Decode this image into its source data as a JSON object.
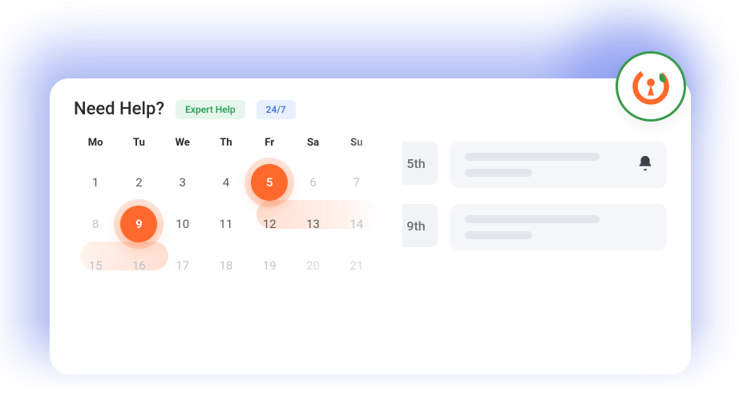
{
  "header": {
    "title": "Need Help?",
    "expert_badge": "Expert Help",
    "always_badge": "24/7"
  },
  "calendar": {
    "dow": [
      "Mo",
      "Tu",
      "We",
      "Th",
      "Fr",
      "Sa",
      "Su"
    ],
    "weeks": [
      [
        {
          "n": "1"
        },
        {
          "n": "2"
        },
        {
          "n": "3"
        },
        {
          "n": "4"
        },
        {
          "n": "5",
          "selected": true
        },
        {
          "n": "6",
          "muted": true
        },
        {
          "n": "7",
          "muted": true
        }
      ],
      [
        {
          "n": "8",
          "muted": true
        },
        {
          "n": "9",
          "selected": true
        },
        {
          "n": "10"
        },
        {
          "n": "11"
        },
        {
          "n": "12"
        },
        {
          "n": "13"
        },
        {
          "n": "14",
          "muted": true
        }
      ],
      [
        {
          "n": "15",
          "muted": true
        },
        {
          "n": "16",
          "muted": true
        },
        {
          "n": "17",
          "muted": true
        },
        {
          "n": "18",
          "muted": true
        },
        {
          "n": "19",
          "muted": true
        },
        {
          "n": "20",
          "faded": true
        },
        {
          "n": "21",
          "faded": true
        }
      ]
    ]
  },
  "events": [
    {
      "date_label": "5th",
      "has_bell": true
    },
    {
      "date_label": "9th",
      "has_bell": false
    }
  ],
  "colors": {
    "accent_orange": "#ff6a2c",
    "brand_green": "#3a9a4d",
    "glow_blue": "#7a8ff0"
  }
}
